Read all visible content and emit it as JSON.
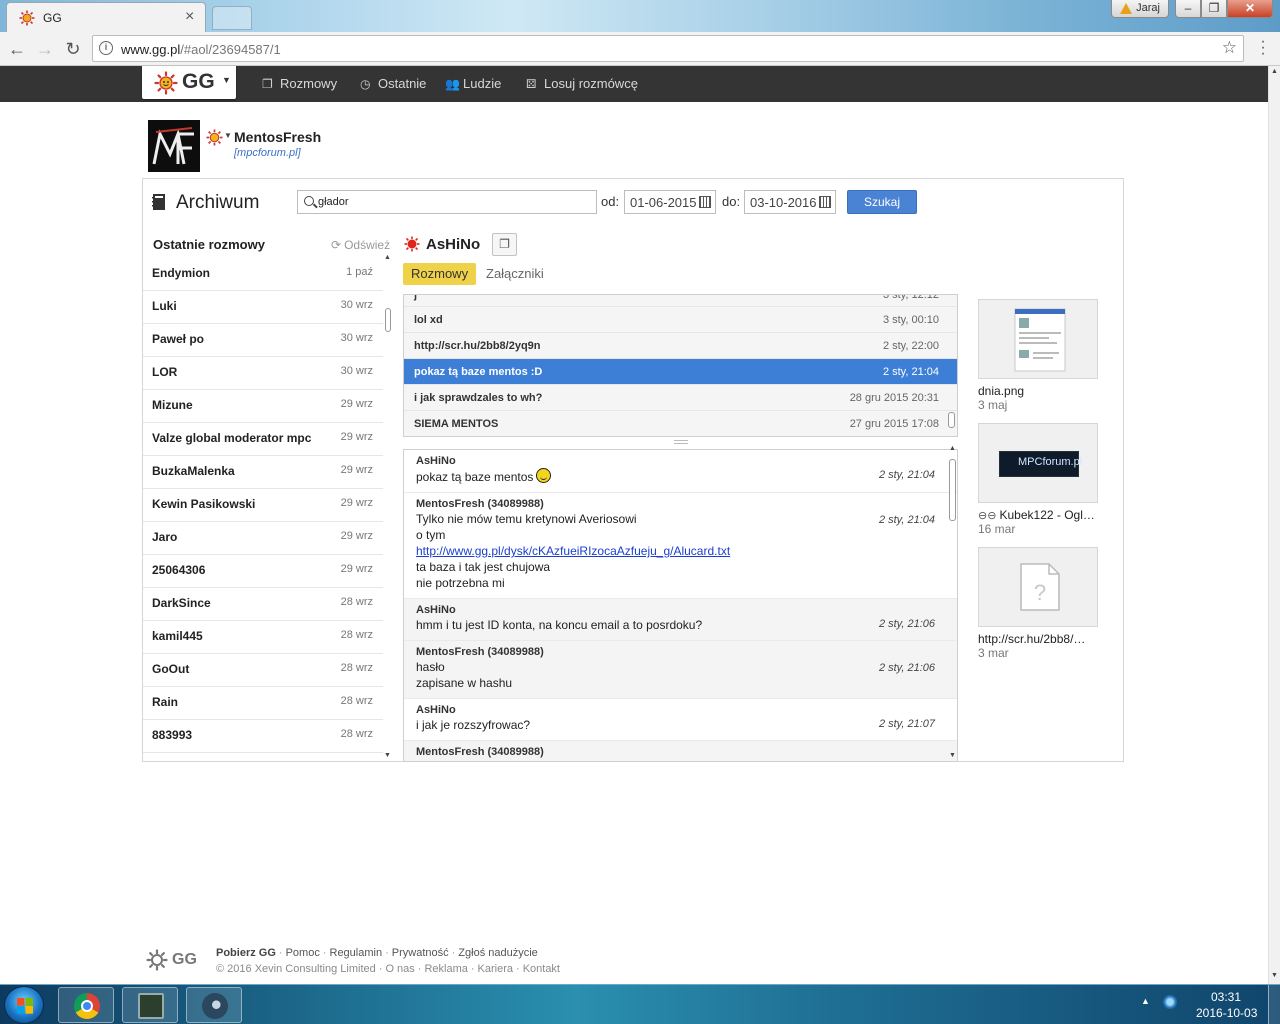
{
  "browser": {
    "tab_title": "GG",
    "url_host": "www.gg.pl",
    "url_path": "/#aol/23694587/1",
    "user_label": "Jaraj"
  },
  "app": {
    "logo_text": "GG",
    "nav": [
      {
        "label": "Rozmowy",
        "icon": "chat-icon"
      },
      {
        "label": "Ostatnie",
        "icon": "clock-icon"
      },
      {
        "label": "Ludzie",
        "icon": "people-icon"
      },
      {
        "label": "Losuj rozmówcę",
        "icon": "random-icon"
      }
    ]
  },
  "profile": {
    "name": "MentosFresh",
    "description": "[mpcforum.pl]"
  },
  "archive": {
    "title": "Archiwum",
    "search_value": "głador",
    "from_label": "od:",
    "from_date": "01-06-2015",
    "to_label": "do:",
    "to_date": "03-10-2016",
    "search_button": "Szukaj"
  },
  "recent": {
    "title": "Ostatnie rozmowy",
    "refresh_label": "Odśwież",
    "items": [
      {
        "name": "Endymion",
        "date": "1 paź"
      },
      {
        "name": "Luki",
        "date": "30 wrz"
      },
      {
        "name": "Paweł po",
        "date": "30 wrz"
      },
      {
        "name": "LOR",
        "date": "30 wrz"
      },
      {
        "name": "Mizune",
        "date": "29 wrz"
      },
      {
        "name": "Valze global moderator mpc",
        "date": "29 wrz"
      },
      {
        "name": "BuzkaMalenka",
        "date": "29 wrz"
      },
      {
        "name": "Kewin Pasikowski",
        "date": "29 wrz"
      },
      {
        "name": "Jaro",
        "date": "29 wrz"
      },
      {
        "name": "25064306",
        "date": "29 wrz"
      },
      {
        "name": "DarkSince",
        "date": "28 wrz"
      },
      {
        "name": "kamil445",
        "date": "28 wrz"
      },
      {
        "name": "GoOut",
        "date": "28 wrz"
      },
      {
        "name": "Rain",
        "date": "28 wrz"
      },
      {
        "name": "883993",
        "date": "28 wrz"
      }
    ]
  },
  "contact": {
    "name": "AsHiNo",
    "tab_conversations": "Rozmowy",
    "tab_attachments": "Załączniki"
  },
  "conversations": [
    {
      "text": "j",
      "date": "3 sty, 12:12",
      "partial": true
    },
    {
      "text": "lol xd",
      "date": "3 sty, 00:10"
    },
    {
      "text": "http://scr.hu/2bb8/2yq9n",
      "date": "2 sty, 22:00"
    },
    {
      "text": "pokaz tą baze mentos :D",
      "date": "2 sty, 21:04",
      "selected": true
    },
    {
      "text": "i jak sprawdzales to wh?",
      "date": "28 gru 2015 20:31"
    },
    {
      "text": "SIEMA MENTOS",
      "date": "27 gru 2015 17:08"
    }
  ],
  "messages": [
    {
      "author": "AsHiNo",
      "lines": [
        "pokaz tą baze mentos"
      ],
      "smiley": true,
      "time": "2 sty, 21:04",
      "gray": false
    },
    {
      "author": "MentosFresh (34089988)",
      "lines": [
        "Tylko nie mów temu kretynowi Averiosowi",
        "o tym"
      ],
      "link": "http://www.gg.pl/dysk/cKAzfueiRIzocaAzfueju_g/Alucard.txt",
      "after": [
        "ta baza i tak jest chujowa",
        "nie potrzebna mi"
      ],
      "time": "2 sty, 21:04",
      "gray": false
    },
    {
      "author": "AsHiNo",
      "lines": [
        "hmm i tu jest ID konta, na koncu email a to posrdoku?"
      ],
      "time": "2 sty, 21:06",
      "gray": true
    },
    {
      "author": "MentosFresh (34089988)",
      "lines": [
        "hasło",
        "zapisane w hashu"
      ],
      "time": "2 sty, 21:06",
      "gray": true
    },
    {
      "author": "AsHiNo",
      "lines": [
        "i jak je rozszyfrowac?"
      ],
      "time": "2 sty, 21:07",
      "gray": false
    },
    {
      "author": "MentosFresh (34089988)",
      "lines": [],
      "time": "",
      "gray": true
    }
  ],
  "attachments": [
    {
      "name": "dnia.png",
      "date": "3 maj",
      "kind": "screenshot"
    },
    {
      "name": "Kubek122 - Ogl…",
      "date": "16 mar",
      "kind": "link",
      "logo_text": "MPCforum.pl"
    },
    {
      "name": "http://scr.hu/2bb8/…",
      "date": "3 mar",
      "kind": "file"
    }
  ],
  "footer": {
    "logo_text": "GG",
    "links": [
      "Pobierz GG",
      "Pomoc",
      "Regulamin",
      "Prywatność",
      "Zgłoś nadużycie"
    ],
    "copyright": "© 2016 Xevin Consulting Limited",
    "links2": [
      "O nas",
      "Reklama",
      "Kariera",
      "Kontakt"
    ]
  },
  "taskbar": {
    "time": "03:31",
    "date": "2016-10-03"
  },
  "colors": {
    "accent_blue": "#4a82d4",
    "selected_row": "#3d7fd6",
    "active_tab": "#f0d24a",
    "topbar": "#343434"
  }
}
